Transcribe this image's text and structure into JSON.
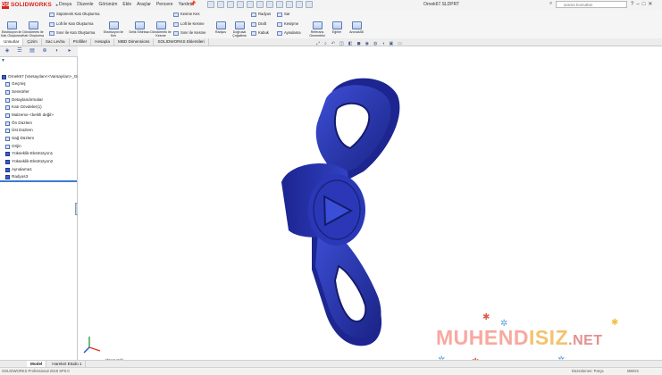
{
  "app": {
    "name": "SOLIDWORKS",
    "logo_letters": "DS"
  },
  "menu": [
    "Dosya",
    "Düzenle",
    "Görünüm",
    "Ekle",
    "Araçlar",
    "Pencere",
    "Yardım"
  ],
  "document_title": "Ornek67.SLDPRT",
  "search": {
    "placeholder": "arama komutları"
  },
  "window_buttons": [
    "?",
    "–",
    "□",
    "✕"
  ],
  "command_manager": {
    "big_tools": [
      "Ekstrüzyon ile Katı Oluşturma",
      "Döndürerek ile Katı Oluşturma",
      "Ekstrüzyon ile Kes",
      "Delik Sihirbazı",
      "Döndürerek ile Kesme",
      "Radyus",
      "Doğrusal Çoğaltma",
      "Referans Geometrisi",
      "Eğriler",
      "Anında3B"
    ],
    "small_tools": [
      "Süpürerek Katı Oluşturma",
      "Loft ile Katı Oluşturma",
      "Sınır ile Katı Oluşturma",
      "Kesme Kes",
      "Loft ile Kesme",
      "Sınır ile Kesme",
      "Radyus",
      "Draft",
      "Kabuk",
      "Sar",
      "Kesişme",
      "Aynalama"
    ]
  },
  "tabs": [
    "Unsurlar",
    "Çizim",
    "Sac Levha",
    "Profiller",
    "Hesapla",
    "MBD Dimensions",
    "SOLIDWORKS Eklentileri"
  ],
  "tree": {
    "root": "Ornek67 (Varsayılan<<Varsayılan>_Gö",
    "items": [
      "Geçmiş",
      "Sensörler",
      "Detaylandırmalar",
      "Katı Gövdeler(1)",
      "Malzeme <belirli değil>",
      "Ön Düzlem",
      "Üst Düzlem",
      "Sağ Düzlem",
      "Orijin",
      "Yükseklik-Ekstrüzyon1",
      "Yükseklik-Ekstrüzyon2",
      "Aynalama1",
      "Radyus3"
    ]
  },
  "viewport": {
    "view_label": "*İzometrik",
    "part_color": "#2a38b0"
  },
  "watermark": {
    "part_a": "MUHEND",
    "part_b": "ISIZ",
    "part_c": ".NET"
  },
  "bottom_tabs": [
    "Model",
    "Hareket Etüdü 1"
  ],
  "status_bar": {
    "left": "SOLIDWORKS Professional 2018 SP0.0",
    "right": "Düzenlenen: Parça",
    "units": "MMGS"
  }
}
